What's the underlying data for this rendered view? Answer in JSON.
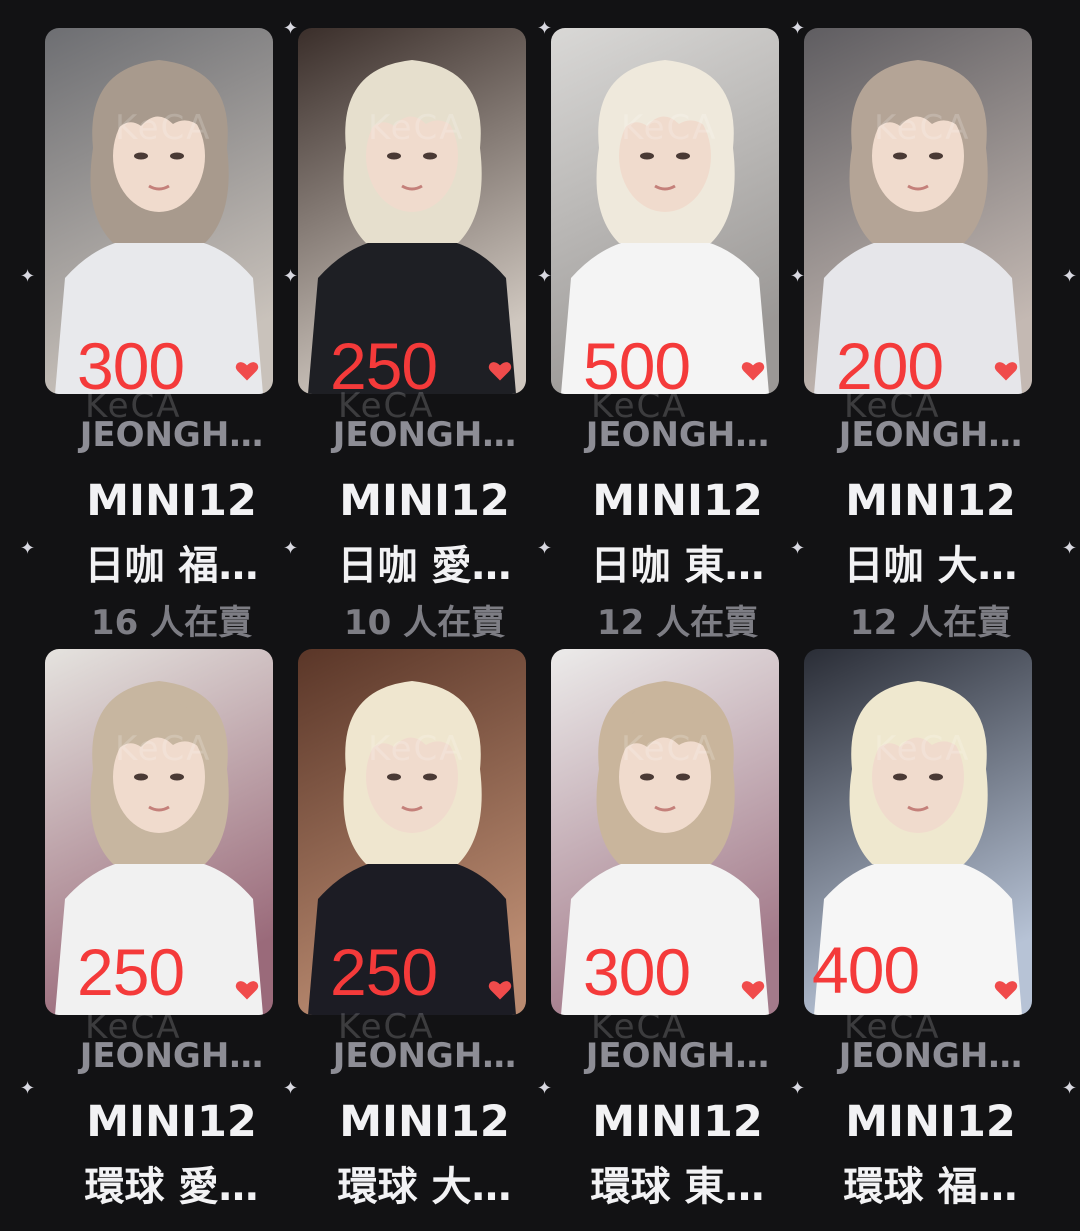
{
  "watermark_text": "KeCA",
  "colors": {
    "background": "#121214",
    "price": "#f43a3a",
    "heart": "#f04b4b",
    "member_text": "#8d8d95",
    "title_text": "#f2f2f4",
    "sellers_text": "#7d7d84"
  },
  "cards": [
    {
      "price": "300",
      "member": "JEONGH…",
      "album": "MINI12",
      "version": "日咖 福…",
      "sellers": "16 人在賣",
      "heart_icon": "heart-icon",
      "bg": [
        "#6d6e72",
        "#c9c2bb"
      ],
      "hair": "#a89a8d",
      "shirt": "#e8e9ec"
    },
    {
      "price": "250",
      "member": "JEONGH…",
      "album": "MINI12",
      "version": "日咖 愛…",
      "sellers": "10 人在賣",
      "heart_icon": "heart-icon",
      "bg": [
        "#3a2e2a",
        "#cfc7bf"
      ],
      "hair": "#e6dfcd",
      "shirt": "#1e1f24"
    },
    {
      "price": "500",
      "member": "JEONGH…",
      "album": "MINI12",
      "version": "日咖 東…",
      "sellers": "12 人在賣",
      "heart_icon": "heart-icon",
      "bg": [
        "#d9d8d6",
        "#9b9896"
      ],
      "hair": "#efe9dc",
      "shirt": "#f4f4f4"
    },
    {
      "price": "200",
      "member": "JEONGH…",
      "album": "MINI12",
      "version": "日咖 大…",
      "sellers": "12 人在賣",
      "heart_icon": "heart-icon",
      "bg": [
        "#5f5d61",
        "#c4b9b3"
      ],
      "hair": "#b4a496",
      "shirt": "#e6e6ea"
    },
    {
      "price": "250",
      "member": "JEONGH…",
      "album": "MINI12",
      "version": "環球 愛…",
      "sellers": "",
      "heart_icon": "heart-icon",
      "bg": [
        "#e5e3df",
        "#9a6a7a"
      ],
      "hair": "#c7b6a0",
      "shirt": "#f1f1f1"
    },
    {
      "price": "250",
      "member": "JEONGH…",
      "album": "MINI12",
      "version": "環球 大…",
      "sellers": "",
      "heart_icon": "heart-icon",
      "bg": [
        "#5a3628",
        "#b98a70"
      ],
      "hair": "#efe6cf",
      "shirt": "#1c1c24"
    },
    {
      "price": "300",
      "member": "JEONGH…",
      "album": "MINI12",
      "version": "環球 東…",
      "sellers": "",
      "heart_icon": "heart-icon",
      "bg": [
        "#ecebea",
        "#a37a8a"
      ],
      "hair": "#c9b59c",
      "shirt": "#f3f3f3"
    },
    {
      "price": "400",
      "member": "JEONGH…",
      "album": "MINI12",
      "version": "環球 福…",
      "sellers": "",
      "heart_icon": "heart-icon",
      "bg": [
        "#2a2d36",
        "#b7c3d6"
      ],
      "hair": "#efe8cf",
      "shirt": "#f6f6f6"
    }
  ]
}
